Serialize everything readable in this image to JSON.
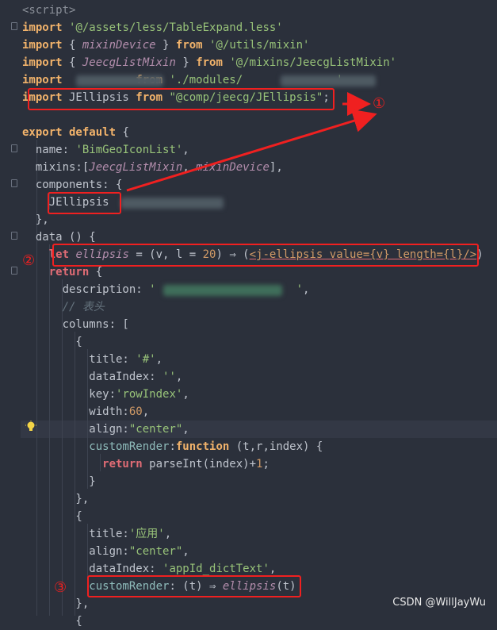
{
  "lines": [
    {
      "parts": [
        [
          "tag",
          "<script>"
        ]
      ]
    },
    {
      "parts": [
        [
          "kw",
          "import"
        ],
        [
          "punc",
          " "
        ],
        [
          "str",
          "'@/assets/less/TableExpand.less'"
        ]
      ]
    },
    {
      "parts": [
        [
          "kw",
          "import"
        ],
        [
          "punc",
          " { "
        ],
        [
          "ital",
          "mixinDevice"
        ],
        [
          "punc",
          " } "
        ],
        [
          "kw",
          "from"
        ],
        [
          "punc",
          " "
        ],
        [
          "str",
          "'@/utils/mixin'"
        ]
      ]
    },
    {
      "parts": [
        [
          "kw",
          "import"
        ],
        [
          "punc",
          " { "
        ],
        [
          "ital",
          "JeecgListMixin"
        ],
        [
          "punc",
          " } "
        ],
        [
          "kw",
          "from"
        ],
        [
          "punc",
          " "
        ],
        [
          "str",
          "'@/mixins/JeecgListMixin'"
        ]
      ]
    },
    {
      "parts": [
        [
          "kw",
          "import"
        ],
        [
          "punc",
          "           "
        ],
        [
          "kw",
          "from"
        ],
        [
          "punc",
          " "
        ],
        [
          "str",
          "'./modules/              '"
        ]
      ]
    },
    {
      "parts": [
        [
          "kw",
          "import"
        ],
        [
          "punc",
          " JEllipsis "
        ],
        [
          "kw",
          "from"
        ],
        [
          "punc",
          " "
        ],
        [
          "str",
          "\"@comp/jeecg/JEllipsis\""
        ],
        [
          "punc",
          ";"
        ]
      ]
    },
    {
      "parts": []
    },
    {
      "parts": [
        [
          "kw",
          "export default"
        ],
        [
          "punc",
          " {"
        ]
      ]
    },
    {
      "parts": [
        [
          "punc",
          "  name: "
        ],
        [
          "str",
          "'BimGeoIconList'"
        ],
        [
          "punc",
          ","
        ]
      ]
    },
    {
      "parts": [
        [
          "punc",
          "  mixins:["
        ],
        [
          "ital",
          "JeecgListMixin"
        ],
        [
          "punc",
          ", "
        ],
        [
          "ital",
          "mixinDevice"
        ],
        [
          "punc",
          "],"
        ]
      ]
    },
    {
      "parts": [
        [
          "punc",
          "  components: {"
        ]
      ]
    },
    {
      "parts": [
        [
          "punc",
          "    JEllipsis"
        ]
      ]
    },
    {
      "parts": [
        [
          "punc",
          "  },"
        ]
      ]
    },
    {
      "parts": [
        [
          "punc",
          "  data () {"
        ]
      ]
    },
    {
      "parts": [
        [
          "let",
          "    let"
        ],
        [
          "punc",
          " "
        ],
        [
          "ital",
          "ellipsis"
        ],
        [
          "punc",
          " = (v, l = "
        ],
        [
          "num",
          "20"
        ],
        [
          "punc",
          ") ⇒ ("
        ],
        [
          "underline",
          "<j-ellipsis value={v} length={l}/>"
        ],
        [
          "punc",
          ")"
        ]
      ]
    },
    {
      "parts": [
        [
          "ret",
          "    return"
        ],
        [
          "punc",
          " {"
        ]
      ]
    },
    {
      "parts": [
        [
          "punc",
          "      description: "
        ],
        [
          "str",
          "'                     '"
        ],
        [
          "punc",
          ","
        ]
      ]
    },
    {
      "parts": [
        [
          "comment",
          "      // 表头"
        ]
      ]
    },
    {
      "parts": [
        [
          "punc",
          "      columns: ["
        ]
      ]
    },
    {
      "parts": [
        [
          "punc",
          "        {"
        ]
      ]
    },
    {
      "parts": [
        [
          "punc",
          "          title: "
        ],
        [
          "str",
          "'#'"
        ],
        [
          "punc",
          ","
        ]
      ]
    },
    {
      "parts": [
        [
          "punc",
          "          dataIndex: "
        ],
        [
          "str",
          "''"
        ],
        [
          "punc",
          ","
        ]
      ]
    },
    {
      "parts": [
        [
          "punc",
          "          key:"
        ],
        [
          "str",
          "'rowIndex'"
        ],
        [
          "punc",
          ","
        ]
      ]
    },
    {
      "parts": [
        [
          "punc",
          "          width:"
        ],
        [
          "num",
          "60"
        ],
        [
          "punc",
          ","
        ]
      ]
    },
    {
      "parts": [
        [
          "punc",
          "          align:"
        ],
        [
          "str",
          "\"center\""
        ],
        [
          "punc",
          ","
        ]
      ]
    },
    {
      "parts": [
        [
          "fn",
          "          customRender"
        ],
        [
          "punc",
          ":"
        ],
        [
          "kw",
          "function"
        ],
        [
          "punc",
          " (t,r,index) {"
        ]
      ]
    },
    {
      "parts": [
        [
          "ret",
          "            return"
        ],
        [
          "punc",
          " parseInt(index)+"
        ],
        [
          "num",
          "1"
        ],
        [
          "punc",
          ";"
        ]
      ]
    },
    {
      "parts": [
        [
          "punc",
          "          }"
        ]
      ]
    },
    {
      "parts": [
        [
          "punc",
          "        },"
        ]
      ]
    },
    {
      "parts": [
        [
          "punc",
          "        {"
        ]
      ]
    },
    {
      "parts": [
        [
          "punc",
          "          title:"
        ],
        [
          "str",
          "'应用'"
        ],
        [
          "punc",
          ","
        ]
      ]
    },
    {
      "parts": [
        [
          "punc",
          "          align:"
        ],
        [
          "str",
          "\"center\""
        ],
        [
          "punc",
          ","
        ]
      ]
    },
    {
      "parts": [
        [
          "punc",
          "          dataIndex: "
        ],
        [
          "str",
          "'appId_dictText'"
        ],
        [
          "punc",
          ","
        ]
      ]
    },
    {
      "parts": [
        [
          "fn",
          "          customRender"
        ],
        [
          "punc",
          ": (t) ⇒ "
        ],
        [
          "ital",
          "ellipsis"
        ],
        [
          "punc",
          "(t)"
        ]
      ]
    },
    {
      "parts": [
        [
          "punc",
          "        },"
        ]
      ]
    },
    {
      "parts": [
        [
          "punc",
          "        {"
        ]
      ]
    }
  ],
  "markers": {
    "one": "①",
    "two": "②",
    "three": "③"
  },
  "watermark": "CSDN @WillJayWu",
  "colors": {
    "highlight": "#f02020",
    "background": "#2b303b"
  }
}
